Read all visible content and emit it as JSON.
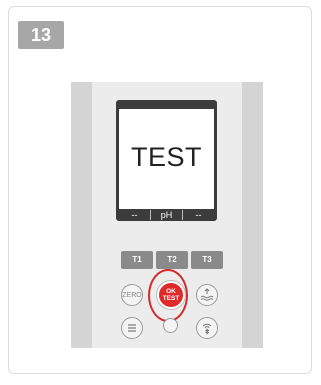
{
  "step": {
    "number": "13"
  },
  "device": {
    "display_text": "TEST",
    "status": {
      "left": "--",
      "center": "pH",
      "right": "--"
    },
    "keys": {
      "t1": "T1",
      "t2": "T2",
      "t3": "T3"
    },
    "zero_label": "ZERO",
    "ok_label_top": "OK",
    "ok_label_bottom": "TEST"
  },
  "colors": {
    "highlight": "#d32a2a",
    "ok_button": "#e02a2a",
    "badge": "#a7a7a7"
  },
  "icons": [
    "zero-button",
    "wave-up-icon",
    "menu-icon",
    "wifi-bluetooth-icon",
    "ok-test-button"
  ]
}
